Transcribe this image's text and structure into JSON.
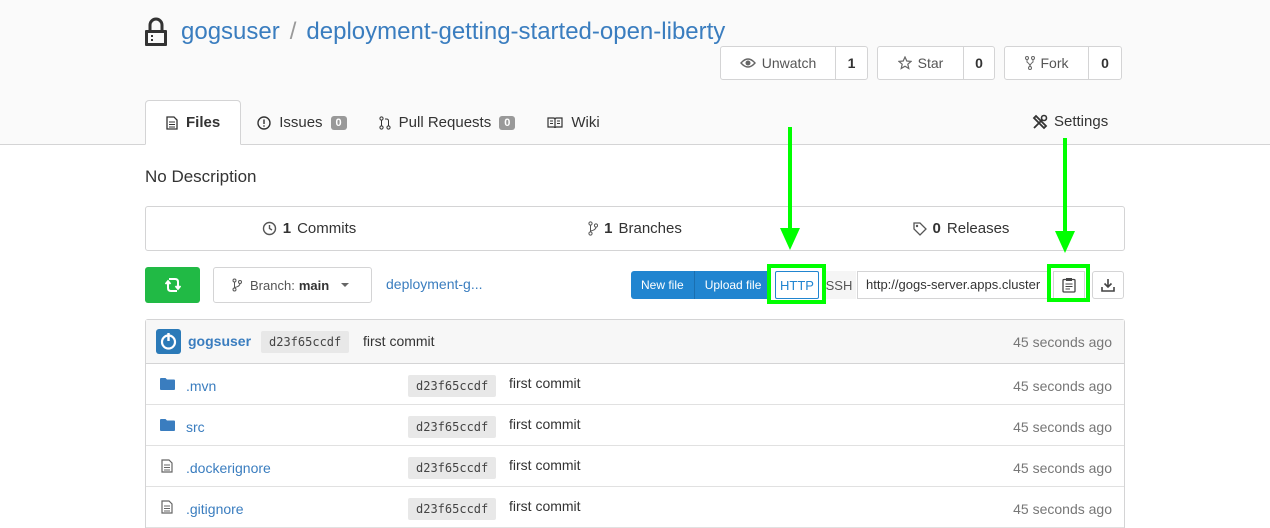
{
  "repo": {
    "owner": "gogsuser",
    "separator": "/",
    "name": "deployment-getting-started-open-liberty"
  },
  "actions": {
    "watch_label": "Unwatch",
    "watch_count": "1",
    "star_label": "Star",
    "star_count": "0",
    "fork_label": "Fork",
    "fork_count": "0"
  },
  "tabs": [
    {
      "label": "Files",
      "icon": "file-icon",
      "active": true
    },
    {
      "label": "Issues",
      "icon": "issue-icon",
      "badge": "0"
    },
    {
      "label": "Pull Requests",
      "icon": "pull-request-icon",
      "badge": "0"
    },
    {
      "label": "Wiki",
      "icon": "book-icon"
    }
  ],
  "settings_label": "Settings",
  "description": "No Description",
  "stats": {
    "commits_count": "1",
    "commits_label": "Commits",
    "branches_count": "1",
    "branches_label": "Branches",
    "releases_count": "0",
    "releases_label": "Releases"
  },
  "toolbar": {
    "branch_prefix": "Branch:",
    "branch_name": "main",
    "breadcrumb": "deployment-g...",
    "new_file": "New file",
    "upload_file": "Upload file",
    "http": "HTTP",
    "ssh": "SSH",
    "clone_url": "http://gogs-server.apps.cluster"
  },
  "latest_commit": {
    "author": "gogsuser",
    "sha": "d23f65ccdf",
    "message": "first commit",
    "time": "45 seconds ago"
  },
  "files": [
    {
      "name": ".mvn",
      "type": "folder",
      "sha": "d23f65ccdf",
      "message": "first commit",
      "time": "45 seconds ago"
    },
    {
      "name": "src",
      "type": "folder",
      "sha": "d23f65ccdf",
      "message": "first commit",
      "time": "45 seconds ago"
    },
    {
      "name": ".dockerignore",
      "type": "file",
      "sha": "d23f65ccdf",
      "message": "first commit",
      "time": "45 seconds ago"
    },
    {
      "name": ".gitignore",
      "type": "file",
      "sha": "d23f65ccdf",
      "message": "first commit",
      "time": "45 seconds ago"
    }
  ],
  "colors": {
    "link": "#3a7dbf",
    "primary": "#2185d0",
    "success": "#21ba45",
    "annotation": "#00ff00"
  }
}
